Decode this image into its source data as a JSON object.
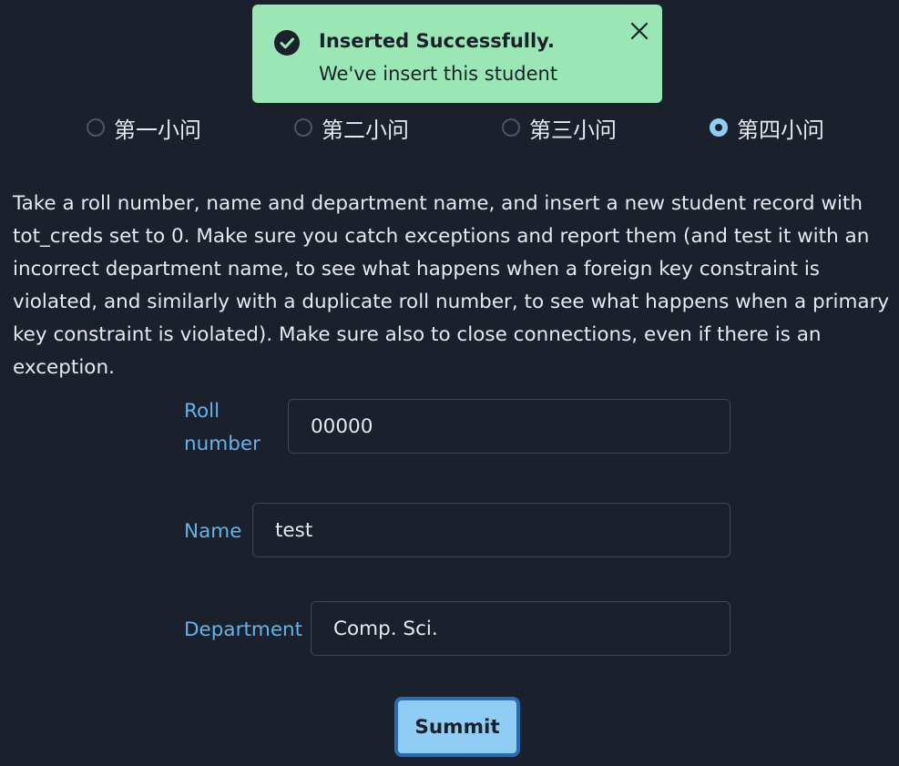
{
  "toast": {
    "title": "Inserted Successfully.",
    "description": "We've insert this student",
    "status_color": "#9ae6b4",
    "icon": "check-circle-icon",
    "close_icon": "close-icon"
  },
  "questions": {
    "options": [
      {
        "label": "第一小问",
        "checked": false
      },
      {
        "label": "第二小问",
        "checked": false
      },
      {
        "label": "第三小问",
        "checked": false
      },
      {
        "label": "第四小问",
        "checked": true
      }
    ]
  },
  "description": "Take a roll number, name and department name, and insert a new student record with tot_creds set to 0. Make sure you catch exceptions and report them (and test it with an incorrect department name, to see what happens when a foreign key constraint is violated, and similarly with a duplicate roll number, to see what happens when a primary key constraint is violated). Make sure also to close connections, even if there is an exception.",
  "form": {
    "roll_label_line1": "Roll",
    "roll_label_line2": "number",
    "roll_value": "00000",
    "name_label": "Name",
    "name_value": "test",
    "department_label": "Department",
    "department_value": "Comp. Sci.",
    "submit_label": "Summit"
  },
  "colors": {
    "background": "#1a202c",
    "accent": "#90cdf4",
    "label": "#63b3ed"
  }
}
